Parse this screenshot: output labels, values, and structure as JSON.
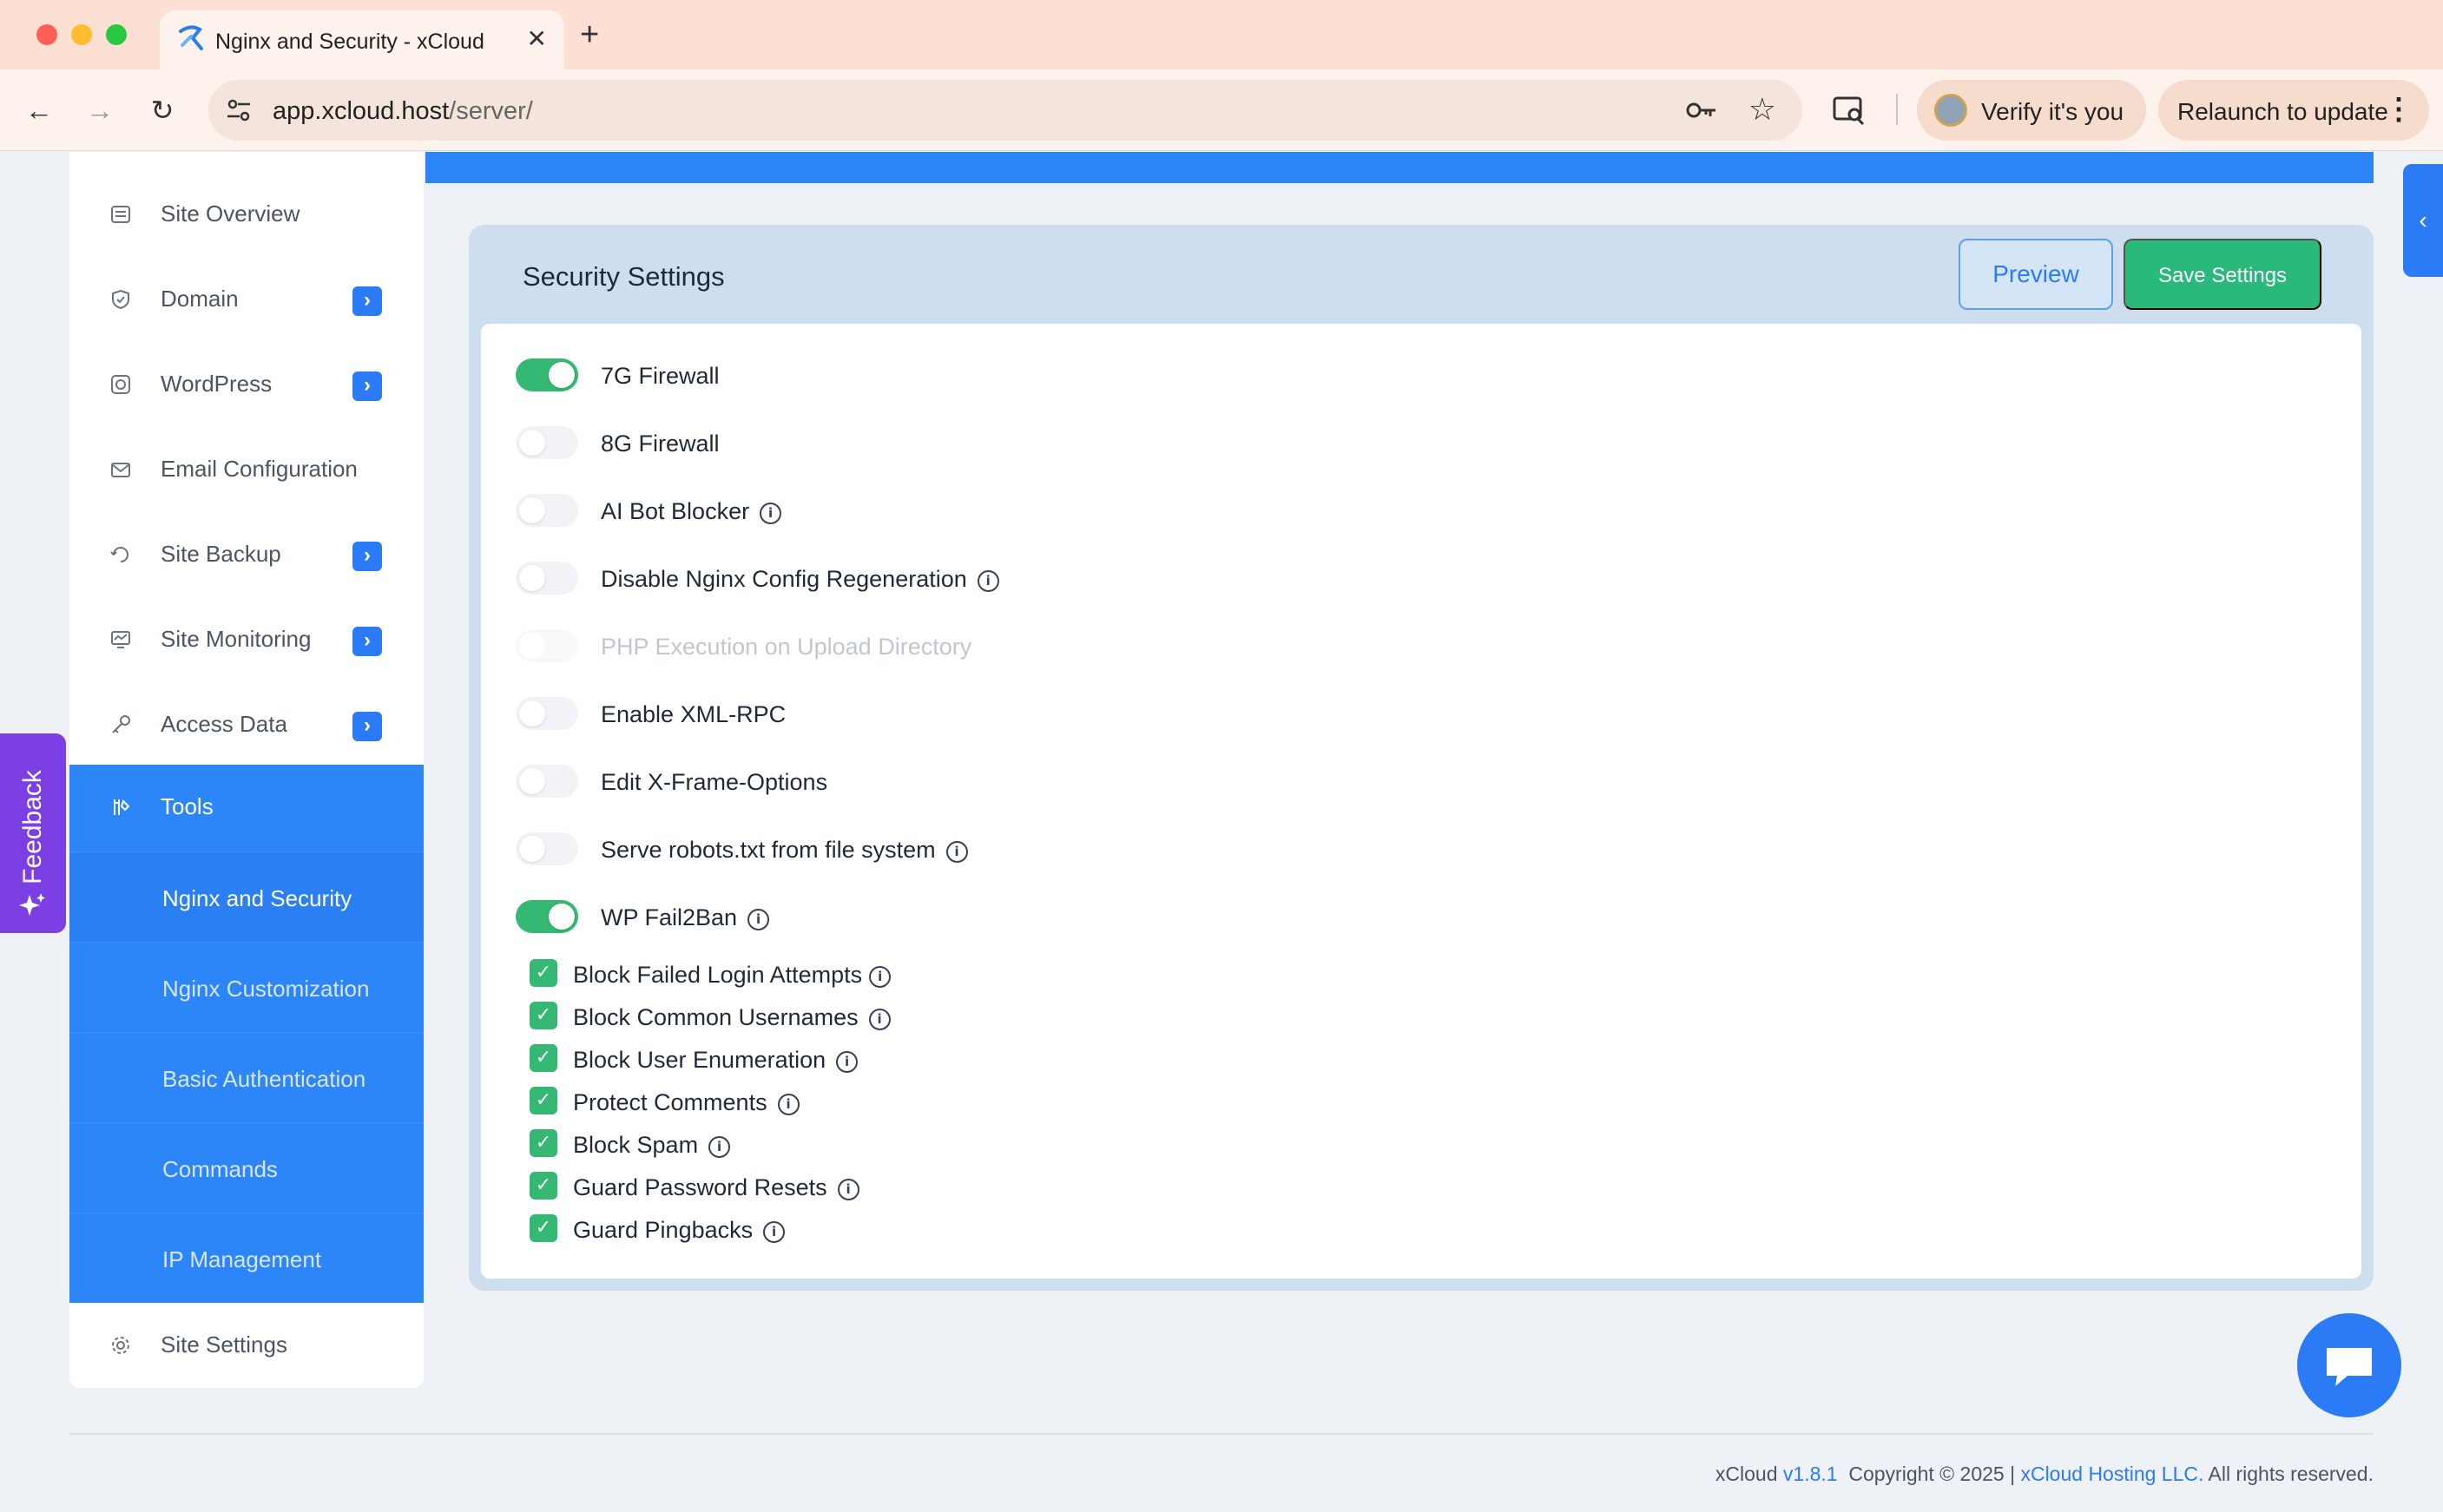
{
  "browser": {
    "tab_title": "Nginx and Security - xCloud",
    "new_tab": "+",
    "close": "✕",
    "url_host": "app.xcloud.host",
    "url_path": "/server/",
    "verify_label": "Verify it's you",
    "relaunch_label": "Relaunch to update"
  },
  "sidebar": {
    "items": [
      {
        "label": "Site Overview",
        "icon": "document-icon",
        "has_chevron": false
      },
      {
        "label": "Domain",
        "icon": "shield-icon",
        "has_chevron": true
      },
      {
        "label": "WordPress",
        "icon": "wordpress-icon",
        "has_chevron": true
      },
      {
        "label": "Email Configuration",
        "icon": "mail-icon",
        "has_chevron": false
      },
      {
        "label": "Site Backup",
        "icon": "backup-icon",
        "has_chevron": true
      },
      {
        "label": "Site Monitoring",
        "icon": "monitor-icon",
        "has_chevron": true
      },
      {
        "label": "Access Data",
        "icon": "key-icon",
        "has_chevron": true
      }
    ],
    "tools_label": "Tools",
    "sub_items": [
      {
        "label": "Nginx and Security",
        "active": true
      },
      {
        "label": "Nginx Customization",
        "active": false
      },
      {
        "label": "Basic Authentication",
        "active": false
      },
      {
        "label": "Commands",
        "active": false
      },
      {
        "label": "IP Management",
        "active": false
      }
    ],
    "settings_label": "Site Settings"
  },
  "feedback_label": "Feedback",
  "security": {
    "title": "Security Settings",
    "preview_label": "Preview",
    "save_label": "Save Settings",
    "toggles": [
      {
        "label": "7G Firewall",
        "on": true,
        "info": false,
        "disabled": false
      },
      {
        "label": "8G Firewall",
        "on": false,
        "info": false,
        "disabled": false
      },
      {
        "label": "AI Bot Blocker",
        "on": false,
        "info": true,
        "disabled": false
      },
      {
        "label": "Disable Nginx Config Regeneration",
        "on": false,
        "info": true,
        "disabled": false
      },
      {
        "label": "PHP Execution on Upload Directory",
        "on": false,
        "info": false,
        "disabled": true
      },
      {
        "label": "Enable XML-RPC",
        "on": false,
        "info": false,
        "disabled": false
      },
      {
        "label": "Edit X-Frame-Options",
        "on": false,
        "info": false,
        "disabled": false
      },
      {
        "label": "Serve robots.txt from file system",
        "on": false,
        "info": true,
        "disabled": false
      },
      {
        "label": "WP Fail2Ban",
        "on": true,
        "info": true,
        "disabled": false
      }
    ],
    "fail2ban_options": [
      {
        "label": "Block Failed Login Attempts",
        "checked": true
      },
      {
        "label": "Block Common Usernames",
        "checked": true
      },
      {
        "label": "Block User Enumeration",
        "checked": true
      },
      {
        "label": "Protect Comments",
        "checked": true
      },
      {
        "label": "Block Spam",
        "checked": true
      },
      {
        "label": "Guard Password Resets",
        "checked": true
      },
      {
        "label": "Guard Pingbacks",
        "checked": true
      }
    ]
  },
  "footer": {
    "brand": "xCloud",
    "version": "v1.8.1",
    "copyright": "Copyright © 2025 |",
    "company": "xCloud Hosting LLC.",
    "rights": "All rights reserved."
  },
  "colors": {
    "accent": "#2d86f7",
    "success": "#34b873",
    "feedback": "#7b3fe4"
  }
}
